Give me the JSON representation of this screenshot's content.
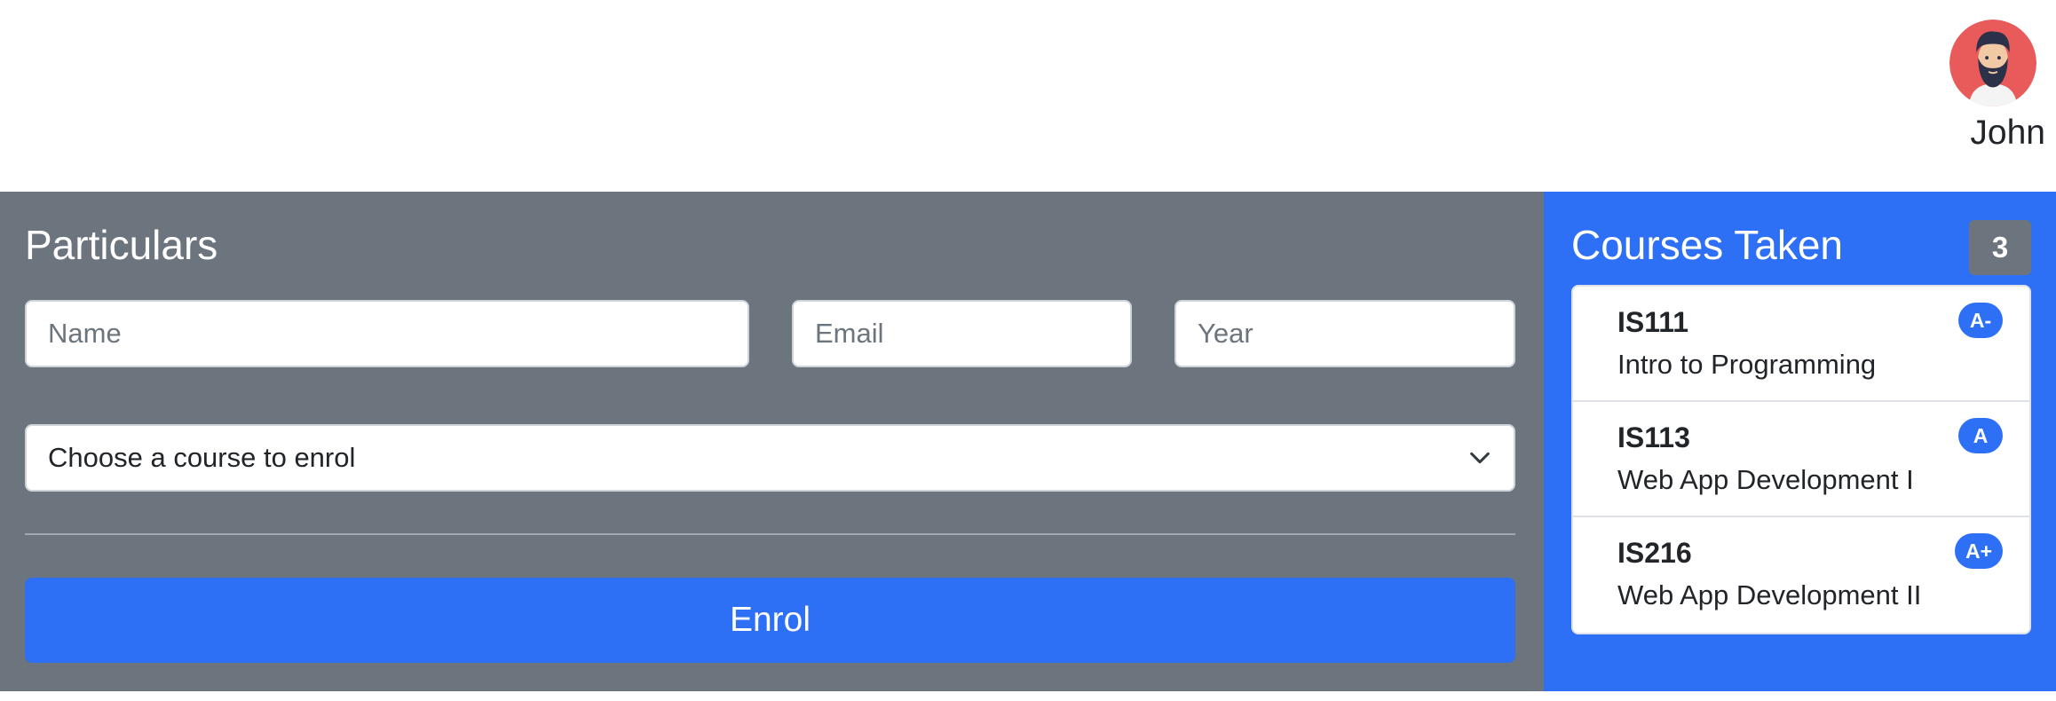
{
  "header": {
    "user_name": "John",
    "avatar_icon": "user-avatar-icon"
  },
  "particulars": {
    "title": "Particulars",
    "name_placeholder": "Name",
    "email_placeholder": "Email",
    "year_placeholder": "Year",
    "course_select_value": "Choose a course to enrol",
    "enrol_label": "Enrol"
  },
  "courses": {
    "title": "Courses Taken",
    "count": "3",
    "items": [
      {
        "code": "IS111",
        "title": "Intro to Programming",
        "grade": "A-"
      },
      {
        "code": "IS113",
        "title": "Web App Development I",
        "grade": "A"
      },
      {
        "code": "IS216",
        "title": "Web App Development II",
        "grade": "A+"
      }
    ]
  },
  "colors": {
    "primary": "#2d6ff5",
    "secondary": "#6c757d",
    "avatar_bg": "#e95a5a"
  }
}
